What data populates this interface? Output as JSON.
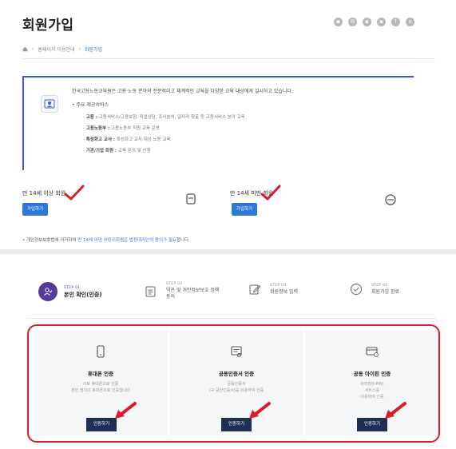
{
  "header": {
    "title": "회원가입",
    "share_icons": [
      "print-icon",
      "email-icon",
      "bookmark-icon",
      "copy-icon",
      "facebook-icon",
      "x-icon"
    ]
  },
  "breadcrumb": {
    "home_icon": "home-icon",
    "items": [
      "홈페이지 이용안내",
      "회원가입"
    ]
  },
  "info": {
    "icon": "id-card-icon",
    "intro": "한국고용노동교육원은 고용·노동 분야의 전문적이고 체계적인 교육을 다양한 교육 대상에게 실시하고 있습니다.",
    "services_title": "• 주요 제공서비스",
    "services": [
      {
        "name": "고용 :",
        "desc": "고용서비스/고용보험, 직업상담, 조사분석, 일자리 창출 등 고용서비스 분야 교육"
      },
      {
        "name": "고용노동부 :",
        "desc": "고용노동부 직원 교육 운영"
      },
      {
        "name": "특성화고 교사 :",
        "desc": "특성화고 교사 대상 노동 교육"
      },
      {
        "name": "기관/기업 회원 :",
        "desc": "교육 문의 및 신청"
      }
    ]
  },
  "join": {
    "over14_label": "만 14세 이상 회원",
    "over14_button": "가입하기",
    "under14_label": "만 14세 미만 회원",
    "under14_button": "가입하기"
  },
  "note": {
    "prefix": "• 개인정보보호법에 의거하여 ",
    "link": "만 14세 미만 어린이회원은 법정대리인의 동의가 필요",
    "suffix": "합니다."
  },
  "steps": [
    {
      "num": "STEP 01",
      "label": "본인 확인(인증)",
      "icon": "person-check-icon",
      "active": true
    },
    {
      "num": "STEP 02",
      "label": "약관 및 개인정보보호 정책 동의",
      "icon": "document-icon",
      "active": false
    },
    {
      "num": "STEP 03",
      "label": "회원정보 입력",
      "icon": "edit-icon",
      "active": false
    },
    {
      "num": "STEP 04",
      "label": "회원가입 완료",
      "icon": "check-circle-icon",
      "active": false
    }
  ],
  "auth_methods": [
    {
      "title": "휴대폰 인증",
      "icon": "mobile-icon",
      "desc": [
        "자료 휴대폰으로 인증",
        "본인 명의의 휴대폰으로 인증합니다"
      ],
      "button": "인증하기"
    },
    {
      "title": "공동인증서 인증",
      "icon": "certificate-icon",
      "desc": [
        "공동인증서",
        "(구 공인인증서)를 이용하여 인증"
      ],
      "button": "인증하기"
    },
    {
      "title": "공동 아이핀 인증",
      "icon": "ipin-card-icon",
      "desc": [
        "아이핀(I-PIN)",
        "서비스를",
        "이용하여 인증"
      ],
      "button": "인증하기"
    }
  ],
  "colors": {
    "primary_blue": "#2f79d6",
    "step_active": "#553c9a",
    "cert_button": "#1f2e54",
    "highlight_red": "#d91e2a"
  }
}
